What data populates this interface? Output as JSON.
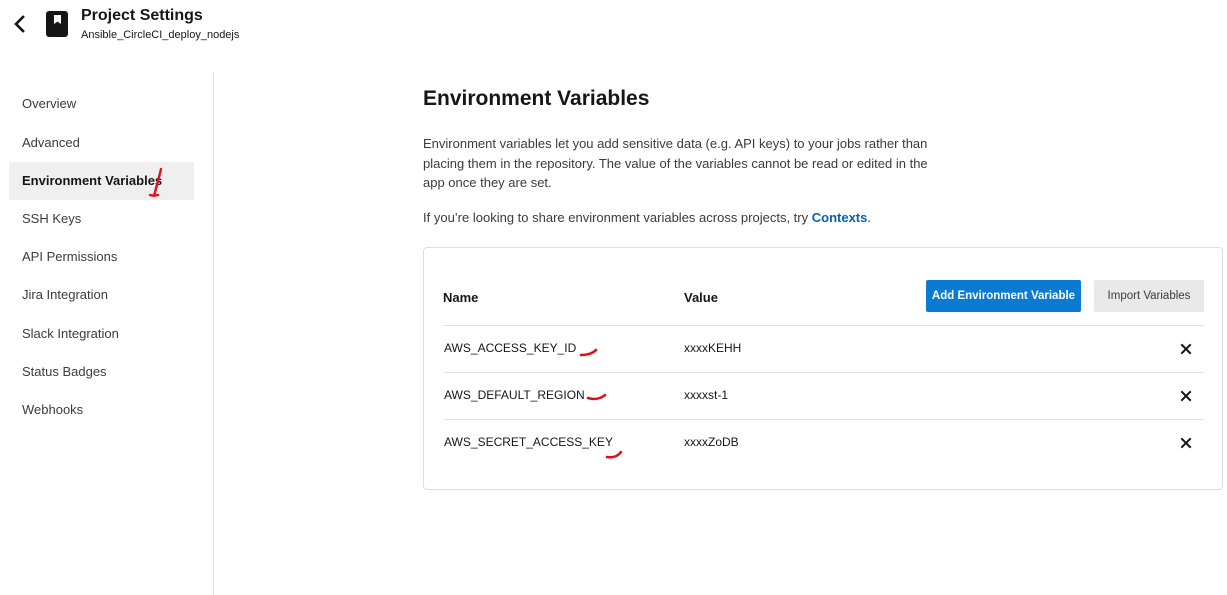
{
  "header": {
    "title": "Project Settings",
    "project_name": "Ansible_CircleCI_deploy_nodejs"
  },
  "sidebar": {
    "items": [
      {
        "label": "Overview",
        "active": false
      },
      {
        "label": "Advanced",
        "active": false
      },
      {
        "label": "Environment Variables",
        "active": true
      },
      {
        "label": "SSH Keys",
        "active": false
      },
      {
        "label": "API Permissions",
        "active": false
      },
      {
        "label": "Jira Integration",
        "active": false
      },
      {
        "label": "Slack Integration",
        "active": false
      },
      {
        "label": "Status Badges",
        "active": false
      },
      {
        "label": "Webhooks",
        "active": false
      }
    ]
  },
  "main": {
    "heading": "Environment Variables",
    "description": "Environment variables let you add sensitive data (e.g. API keys) to your jobs rather than placing them in the repository. The value of the variables cannot be read or edited in the app once they are set.",
    "share_text": "If you’re looking to share environment variables across projects, try ",
    "share_link": "Contexts",
    "share_suffix": "."
  },
  "table": {
    "col_name": "Name",
    "col_value": "Value",
    "add_button": "Add Environment Variable",
    "import_button": "Import Variables",
    "rows": [
      {
        "name": "AWS_ACCESS_KEY_ID",
        "value": "xxxxKEHH"
      },
      {
        "name": "AWS_DEFAULT_REGION",
        "value": "xxxxst-1"
      },
      {
        "name": "AWS_SECRET_ACCESS_KEY",
        "value": "xxxxZoDB"
      }
    ]
  },
  "colors": {
    "primary": "#0b7ad1",
    "link": "#0b5fae",
    "annotation": "#e0101a",
    "active_nav_bg": "#efefef"
  },
  "icons": {
    "back": "chevron-left-icon",
    "project": "bookmark-book-icon",
    "delete": "close-icon"
  }
}
